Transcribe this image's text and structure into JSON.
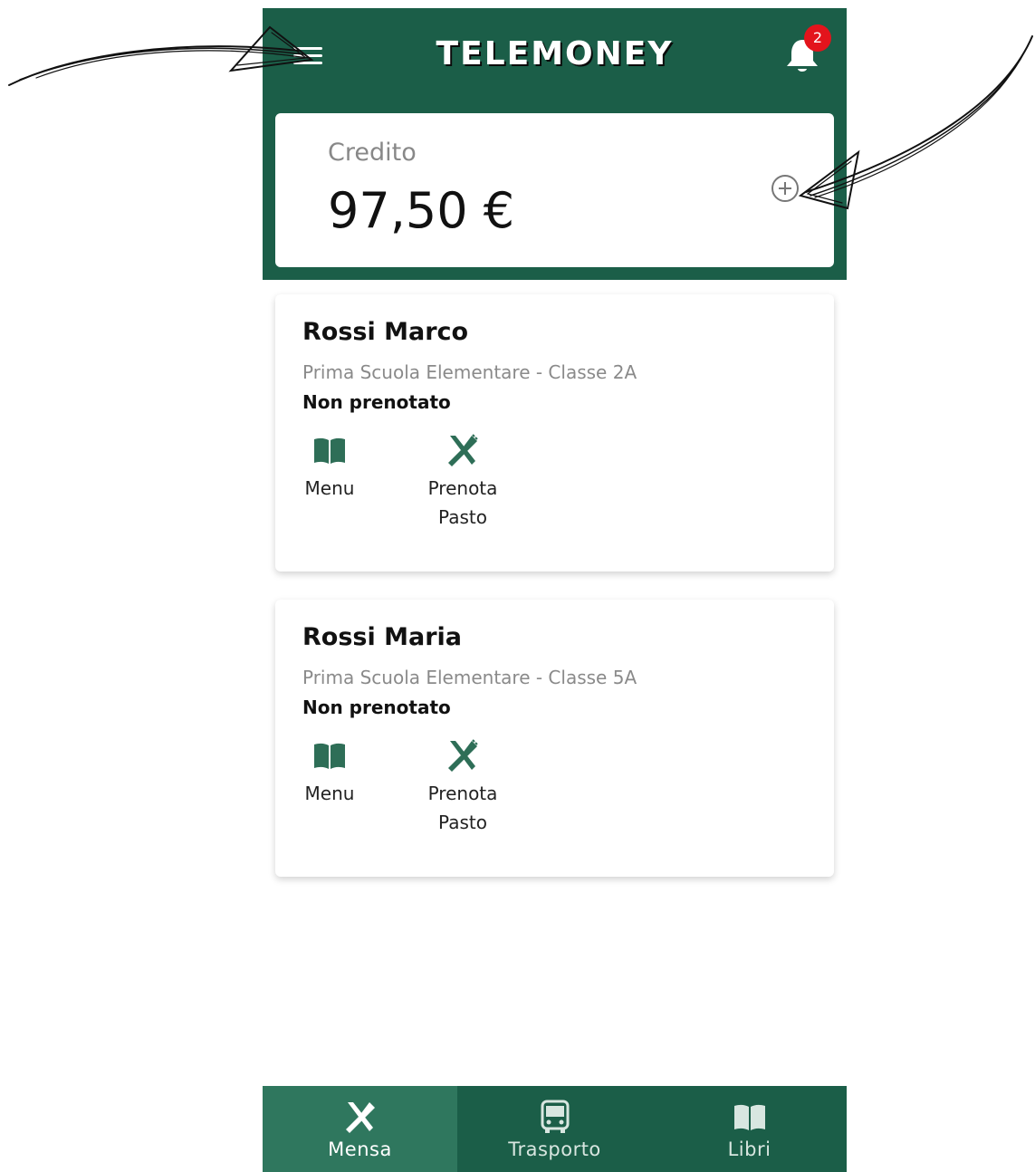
{
  "header": {
    "title": "TELEMONEY",
    "notification_count": "2"
  },
  "credit": {
    "label": "Credito",
    "amount": "97,50 €"
  },
  "students": [
    {
      "name": "Rossi Marco",
      "school": "Prima Scuola Elementare - Classe 2A",
      "status": "Non prenotato",
      "menu_label": "Menu",
      "book_label_line1": "Prenota",
      "book_label_line2": "Pasto"
    },
    {
      "name": "Rossi Maria",
      "school": "Prima Scuola Elementare - Classe 5A",
      "status": "Non prenotato",
      "menu_label": "Menu",
      "book_label_line1": "Prenota",
      "book_label_line2": "Pasto"
    }
  ],
  "bottom_nav": {
    "items": [
      {
        "label": "Mensa",
        "icon": "utensils-icon",
        "active": true
      },
      {
        "label": "Trasporto",
        "icon": "bus-icon",
        "active": false
      },
      {
        "label": "Libri",
        "icon": "book-icon",
        "active": false
      }
    ]
  },
  "colors": {
    "primary": "#1b5e48",
    "active_tab": "#2f775e",
    "badge": "#e3141c"
  }
}
